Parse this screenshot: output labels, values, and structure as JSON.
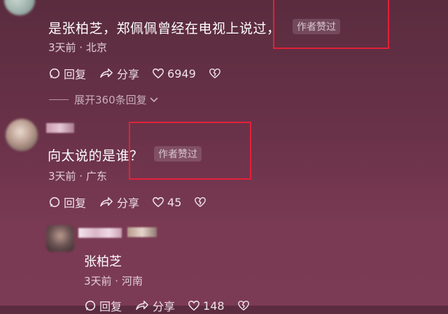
{
  "comments": [
    {
      "text": "是张柏芝，郑佩佩曾经在电视上说过，",
      "badge": "作者赞过",
      "meta": "3天前 · 北京",
      "reply_label": "回复",
      "share_label": "分享",
      "likes": "6949"
    },
    {
      "text": "向太说的是谁？",
      "badge": "作者赞过",
      "meta": "3天前 · 广东",
      "reply_label": "回复",
      "share_label": "分享",
      "likes": "45"
    },
    {
      "text": "张柏芝",
      "meta": "3天前 · 河南",
      "reply_label": "回复",
      "share_label": "分享",
      "likes": "148"
    }
  ],
  "expand_label": "展开360条回复",
  "highlight_color": "#e4203a"
}
